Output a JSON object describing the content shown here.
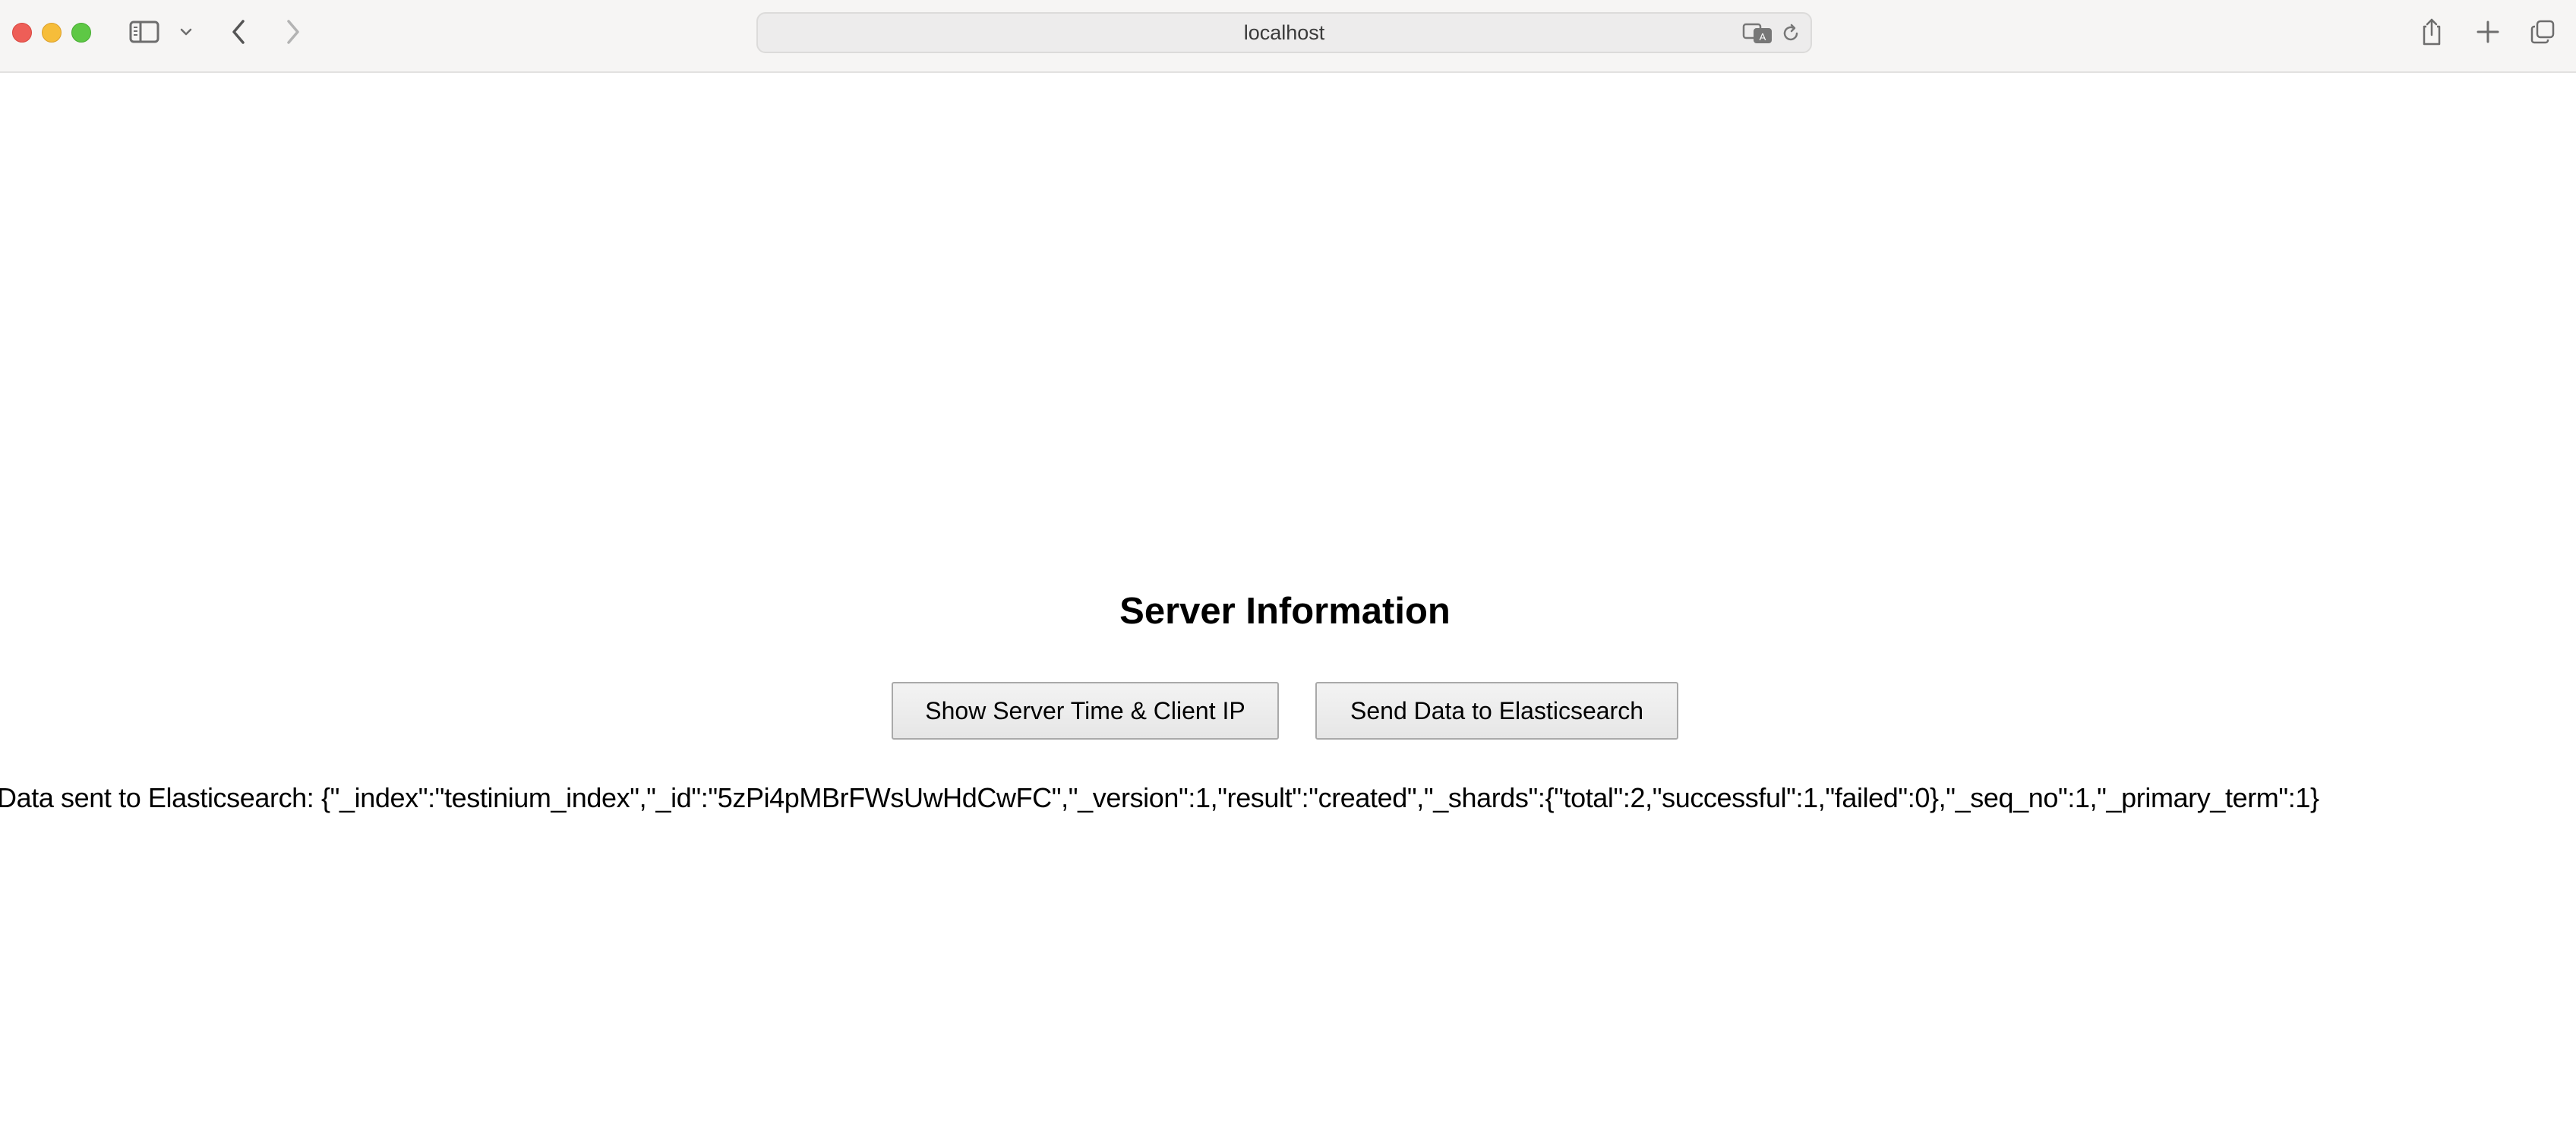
{
  "browser": {
    "address": "localhost",
    "icons": [
      "sidebar-icon",
      "chevron-down-icon",
      "back-icon",
      "forward-icon",
      "translate-icon",
      "reload-icon",
      "share-icon",
      "plus-icon",
      "tabs-icon"
    ]
  },
  "page": {
    "title": "Server Information",
    "buttons": {
      "show_time": "Show Server Time & Client IP",
      "send_es": "Send Data to Elasticsearch"
    },
    "result": "Data sent to Elasticsearch: {\"_index\":\"testinium_index\",\"_id\":\"5zPi4pMBrFWsUwHdCwFC\",\"_version\":1,\"result\":\"created\",\"_shards\":{\"total\":2,\"successful\":1,\"failed\":0},\"_seq_no\":1,\"_primary_term\":1}"
  },
  "colors": {
    "close": "#ee5e57",
    "minimize": "#f6bd3a",
    "maximize": "#5ec845",
    "toolbar": "#f6f5f4"
  }
}
